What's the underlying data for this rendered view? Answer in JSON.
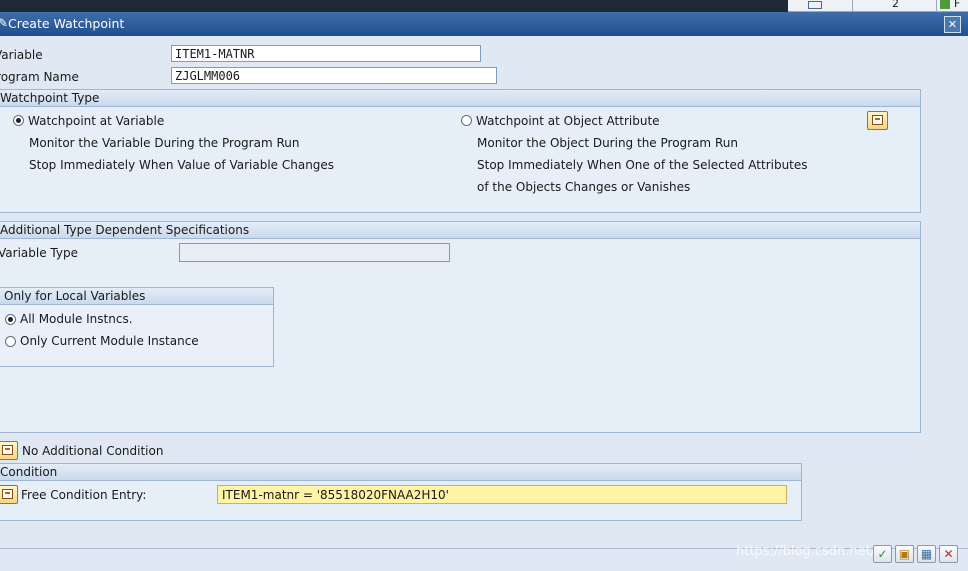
{
  "window": {
    "title": "Create Watchpoint",
    "close_icon": "close-icon"
  },
  "top_strip": {
    "field_value": "2",
    "fragment": "F"
  },
  "fields": {
    "variable_label": "Variable",
    "variable_value": "ITEM1-MATNR",
    "program_label": "Program Name",
    "program_value": "ZJGLMM006"
  },
  "watchpoint_type": {
    "header": "Watchpoint Type",
    "left": {
      "option": "Watchpoint at Variable",
      "selected": true,
      "desc1": "Monitor the Variable During the Program Run",
      "desc2": "Stop Immediately When Value of Variable Changes"
    },
    "right": {
      "option": "Watchpoint at Object Attribute",
      "selected": false,
      "desc1": "Monitor the Object During the Program Run",
      "desc2": "Stop Immediately When One of the Selected Attributes",
      "desc3": "of the Objects Changes or Vanishes"
    }
  },
  "additional_specs": {
    "header": "Additional Type Dependent Specifications",
    "variable_type_label": "Variable Type",
    "variable_type_value": "",
    "local_vars": {
      "header": "Only for Local Variables",
      "opt1": "All Module Instncs.",
      "opt1_selected": true,
      "opt2": "Only Current Module Instance",
      "opt2_selected": false
    }
  },
  "no_condition": {
    "label": "No Additional Condition"
  },
  "condition": {
    "header": "Condition",
    "free_label": "Free Condition Entry:",
    "free_value": "ITEM1-matnr = '85518020FNAA2H10'"
  },
  "watermark": "https://blog.csdn.net/...",
  "footer": {
    "buttons": [
      "confirm-icon",
      "save-icon",
      "options-icon",
      "cancel-icon"
    ]
  },
  "colors": {
    "title_bar": "#1f4f8f",
    "dialog_bg": "#dfe8f3",
    "condition_field": "#fff3a6"
  }
}
